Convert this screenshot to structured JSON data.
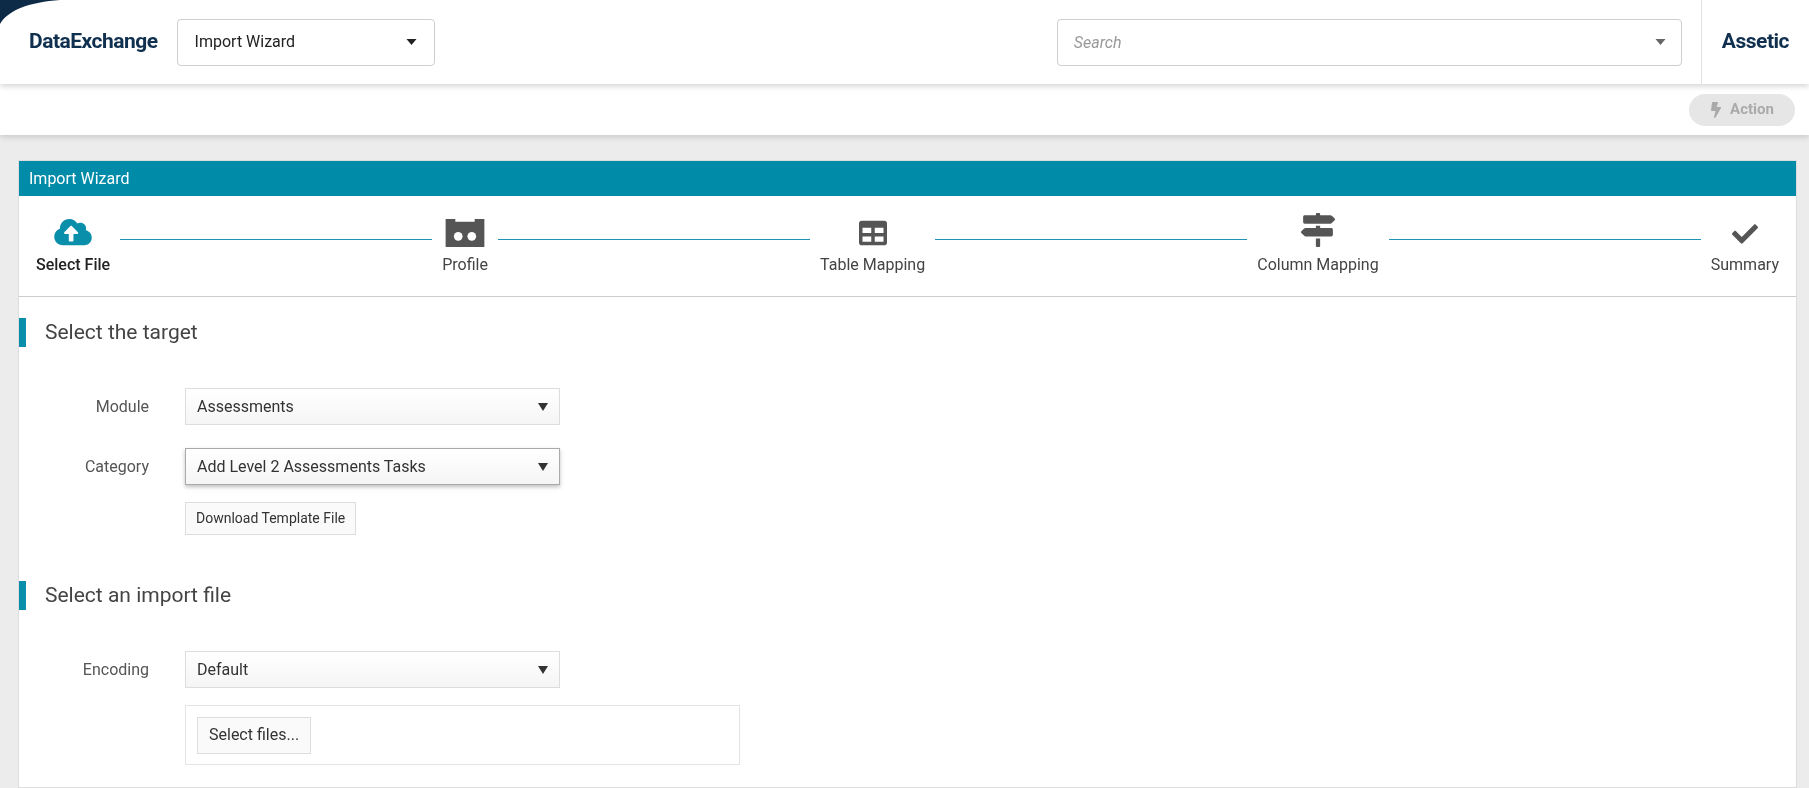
{
  "header": {
    "app_name": "DataExchange",
    "page_select": "Import Wizard",
    "search": {
      "placeholder": "Search"
    },
    "brand": "Assetic"
  },
  "toolbar": {
    "action_button": {
      "label": "Action",
      "disabled": true
    }
  },
  "panel": {
    "title": "Import Wizard",
    "steps": [
      {
        "label": "Select File",
        "kind": "upload",
        "selected": true
      },
      {
        "label": "Profile",
        "kind": "profile",
        "selected": false
      },
      {
        "label": "Table Mapping",
        "kind": "table",
        "selected": false
      },
      {
        "label": "Column Mapping",
        "kind": "signpost",
        "selected": false
      },
      {
        "label": "Summary",
        "kind": "check",
        "selected": false
      }
    ],
    "sections": [
      {
        "title": "Select the target",
        "fields": [
          {
            "label": "Module",
            "value": "Assessments",
            "focused": false
          },
          {
            "label": "Category",
            "value": "Add Level 2 Assessments Tasks",
            "focused": true
          }
        ],
        "button": "Download Template File"
      },
      {
        "title": "Select an import file",
        "fields": [
          {
            "label": "Encoding",
            "value": "Default",
            "focused": false
          }
        ],
        "upload_button": "Select files..."
      }
    ]
  }
}
